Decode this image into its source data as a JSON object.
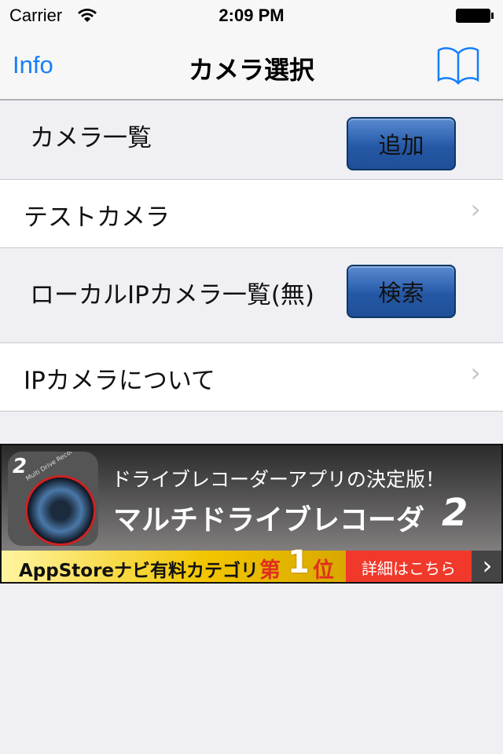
{
  "status_bar": {
    "carrier": "Carrier",
    "time": "2:09 PM",
    "wifi_icon": "wifi-icon",
    "battery_icon": "battery-full-icon"
  },
  "nav": {
    "left_button": "Info",
    "title": "カメラ選択",
    "right_icon": "book-icon",
    "accent": "#157efb"
  },
  "sections": [
    {
      "header": "カメラ一覧",
      "button": "追加",
      "row": "テストカメラ"
    },
    {
      "header": "ローカルIPカメラ一覧(無)",
      "button": "検索",
      "row": "IPカメラについて"
    }
  ],
  "ad": {
    "tagline": "ドライブレコーダーアプリの決定版！",
    "title": "マルチドライブレコーダ",
    "title_num": "2",
    "rank_prefix": "AppStoreナビ有料カテゴリ",
    "rank_a": "第",
    "rank_num": "1",
    "rank_b": "位",
    "details": "詳細はこちら",
    "icon_text": "Multi Drive Recorder"
  }
}
